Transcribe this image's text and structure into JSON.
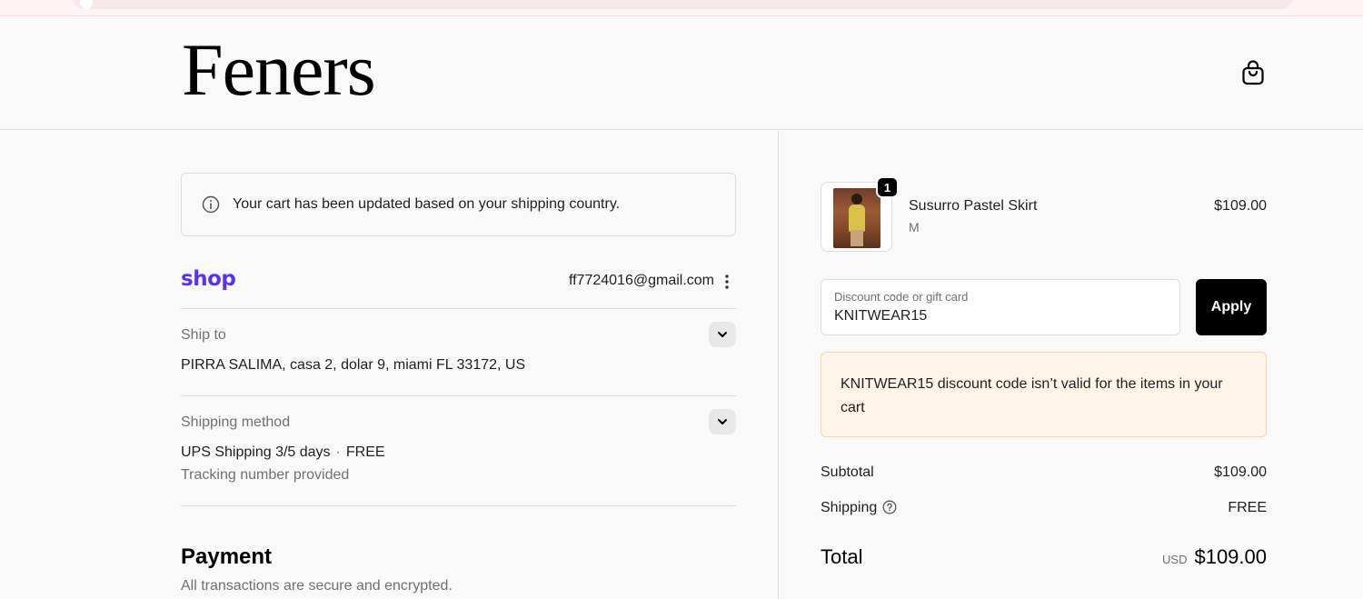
{
  "brand": {
    "name": "Feners"
  },
  "notice": {
    "text": "Your cart has been updated based on your shipping country."
  },
  "shop_account": {
    "logo": "shop",
    "email": "ff7724016@gmail.com"
  },
  "ship_to": {
    "label": "Ship to",
    "address": "PIRRA SALIMA, casa 2, dolar 9, miami FL 33172, US"
  },
  "shipping_method": {
    "label": "Shipping method",
    "name": "UPS Shipping 3/5 days",
    "separator": "·",
    "price": "FREE",
    "note": "Tracking number provided"
  },
  "payment": {
    "title": "Payment",
    "subtitle": "All transactions are secure and encrypted."
  },
  "cart": {
    "items": [
      {
        "quantity": "1",
        "name": "Susurro Pastel Skirt",
        "variant": "M",
        "price": "$109.00"
      }
    ]
  },
  "discount": {
    "label": "Discount code or gift card",
    "value": "KNITWEAR15",
    "apply_label": "Apply",
    "error": "KNITWEAR15 discount code isn’t valid for the items in your cart"
  },
  "summary": {
    "subtotal_label": "Subtotal",
    "subtotal_value": "$109.00",
    "shipping_label": "Shipping",
    "shipping_value": "FREE",
    "total_label": "Total",
    "currency": "USD",
    "total_value": "$109.00"
  },
  "colors": {
    "shop_brand": "#5a31f4",
    "error_bg": "#fff4e8",
    "error_border": "#f8d7a8",
    "primary_button": "#000000"
  },
  "icons": [
    "shopping-bag-icon",
    "info-icon",
    "kebab-menu-icon",
    "chevron-down-icon",
    "help-icon"
  ]
}
